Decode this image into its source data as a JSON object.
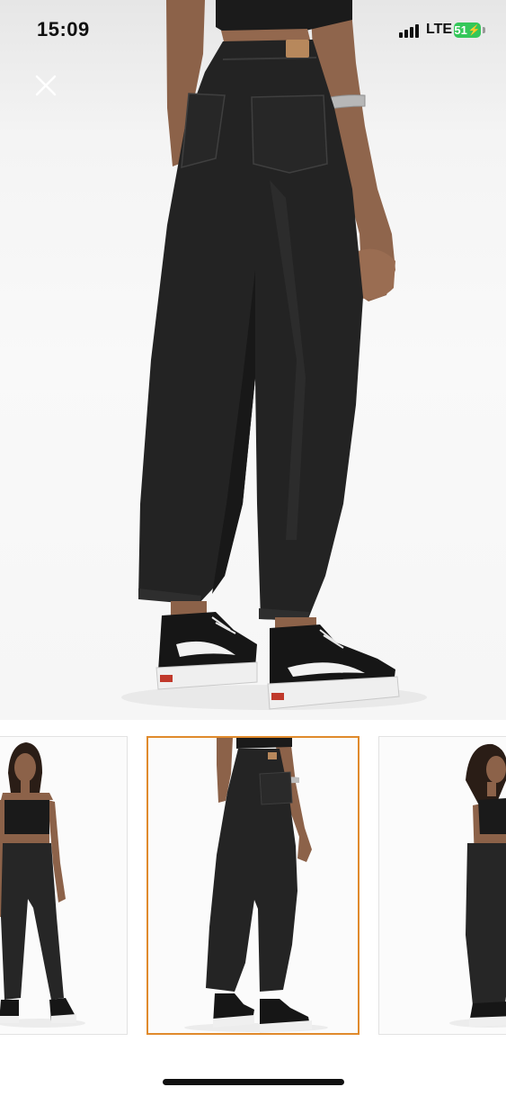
{
  "status_bar": {
    "time": "15:09",
    "network": "LTE",
    "battery": "51"
  },
  "viewer": {
    "close_icon": "close-icon",
    "main_image": "model-back-view-black-barrel-jeans",
    "thumbnails": [
      {
        "view": "front",
        "selected": false
      },
      {
        "view": "back",
        "selected": true
      },
      {
        "view": "side",
        "selected": false
      }
    ]
  },
  "colors": {
    "selected_border": "#e08a2c",
    "battery": "#34c759"
  }
}
